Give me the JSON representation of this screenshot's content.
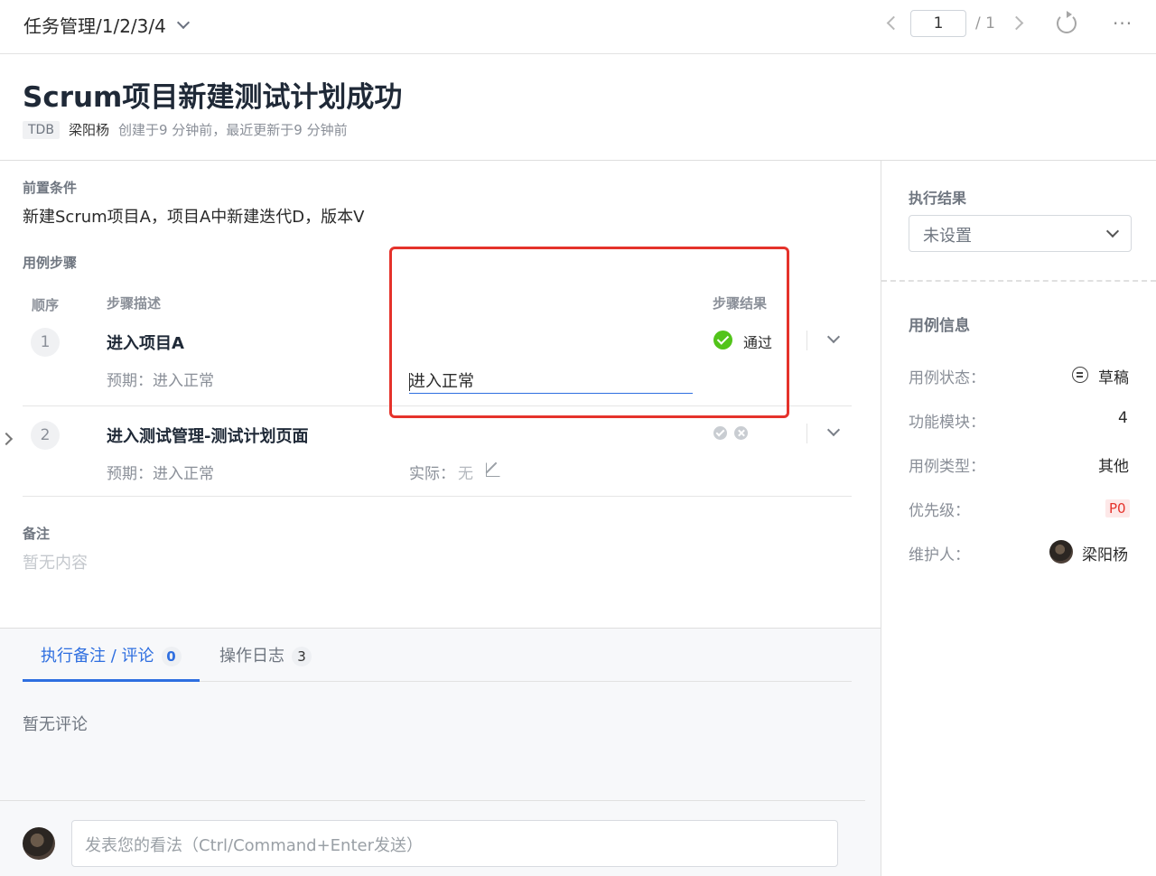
{
  "top_bar": {
    "breadcrumb": "任务管理/1/2/3/4",
    "page_current": "1",
    "page_total": "/ 1",
    "more_glyph": "···"
  },
  "header": {
    "title": "Scrum项目新建测试计划成功",
    "tag": "TDB",
    "author": "梁阳杨",
    "meta_text": "创建于9 分钟前，最近更新于9 分钟前"
  },
  "precondition": {
    "label": "前置条件",
    "text": "新建Scrum项目A，项目A中新建迭代D，版本V"
  },
  "steps": {
    "label": "用例步骤",
    "col_seq": "顺序",
    "col_desc": "步骤描述",
    "col_result": "步骤结果",
    "items": [
      {
        "seq": "1",
        "title": "进入项目A",
        "expected": "预期：进入正常",
        "actual_value": "进入正常",
        "result": "通过"
      },
      {
        "seq": "2",
        "title": "进入测试管理-测试计划页面",
        "expected": "预期：进入正常",
        "actual_label": "实际：",
        "actual_value": "无"
      }
    ]
  },
  "remark": {
    "label": "备注",
    "empty": "暂无内容"
  },
  "comments": {
    "tabs": [
      {
        "label": "执行备注 / 评论",
        "count": "0"
      },
      {
        "label": "操作日志",
        "count": "3"
      }
    ],
    "empty": "暂无评论",
    "input_placeholder": "发表您的看法（Ctrl/Command+Enter发送）"
  },
  "sidebar": {
    "exec_label": "执行结果",
    "exec_value": "未设置",
    "info_title": "用例信息",
    "info": [
      {
        "label": "用例状态：",
        "value": "草稿"
      },
      {
        "label": "功能模块：",
        "value": "4"
      },
      {
        "label": "用例类型：",
        "value": "其他"
      },
      {
        "label": "优先级：",
        "value": "P0"
      },
      {
        "label": "维护人：",
        "value": "梁阳杨"
      }
    ]
  },
  "colors": {
    "primary": "#2f6fe0",
    "pass": "#52c41a",
    "highlight": "#e5322b"
  }
}
